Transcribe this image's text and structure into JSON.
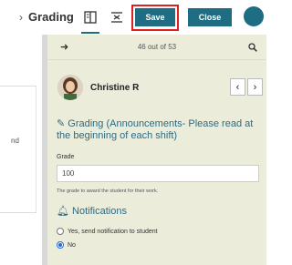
{
  "header": {
    "breadcrumb_sep": "›",
    "title": "Grading",
    "save_label": "Save",
    "close_label": "Close"
  },
  "left": {
    "snippet": "nd"
  },
  "panel": {
    "counter": "46 out of 53",
    "student_name": "Christine R",
    "prev": "‹",
    "next": "›",
    "grading_heading": "Grading (Announcements- Please read at the beginning of each shift)",
    "grade_label": "Grade",
    "grade_value": "100",
    "grade_help": "The grade to award the student for their work.",
    "notifications_heading": "Notifications",
    "notify_yes": "Yes, send notification to student",
    "notify_no": "No"
  },
  "colors": {
    "accent": "#1e6d82",
    "panel_bg": "#ececdb",
    "highlight": "#e02020"
  }
}
